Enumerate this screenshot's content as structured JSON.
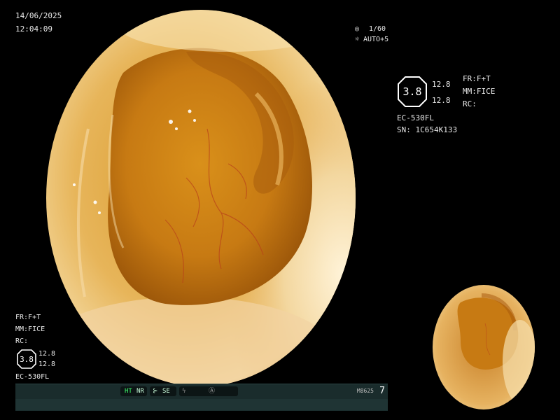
{
  "overlay": {
    "date": "14/06/2025",
    "time": "12:04:09",
    "shutter": "1/60",
    "auto_exposure": "AUTO+5",
    "right_info": {
      "fr": "FR:F+T",
      "mm": "MM:FICE",
      "rc": "RC:",
      "hex_value": "3.8",
      "value_a": "12.8",
      "value_b": "12.8",
      "scope_model": "EC-530FL",
      "serial": "SN: 1C654K133"
    },
    "left_info": {
      "fr": "FR:F+T",
      "mm": "MM:FICE",
      "rc": "RC:",
      "hex_value": "3.8",
      "value_a": "12.8",
      "value_b": "12.8",
      "scope_model": "EC-530FL"
    }
  },
  "status_bar": {
    "ht": "HT",
    "nr": "NR",
    "se": "SE",
    "model_code": "M8625",
    "channel": "7"
  },
  "icons": [
    "shutter-icon",
    "auto-exposure-icon",
    "enhance-icon",
    "flash-icon",
    "record-icon"
  ]
}
